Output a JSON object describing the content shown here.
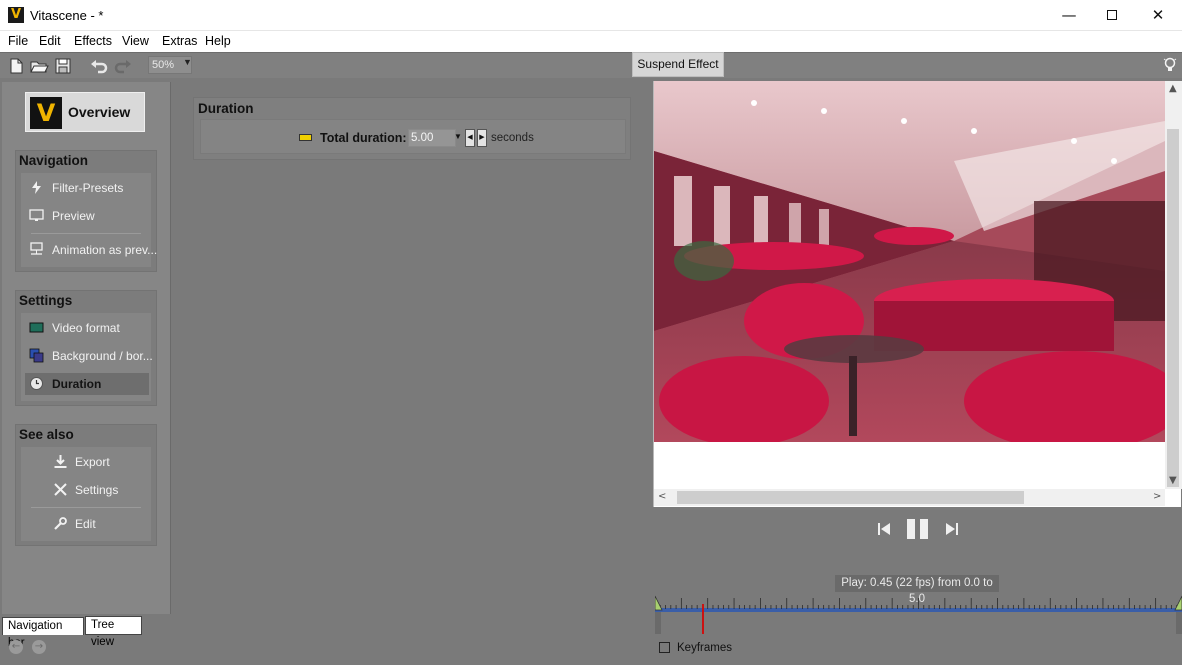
{
  "window": {
    "title": "Vitascene - *",
    "app_icon_letter": "V",
    "minimize_glyph": "—",
    "close_glyph": "✕"
  },
  "menu": [
    {
      "label": "File"
    },
    {
      "label": "Edit"
    },
    {
      "label": "Effects"
    },
    {
      "label": "View"
    },
    {
      "label": "Extras"
    },
    {
      "label": "Help"
    }
  ],
  "toolbar": {
    "zoom_value": "50%",
    "suspend_label": "Suspend Effect",
    "icons": [
      "new-document-icon",
      "open-folder-icon",
      "save-icon",
      "undo-icon",
      "redo-icon",
      "lightbulb-icon"
    ]
  },
  "nav": {
    "overview_label": "Overview",
    "overview_letter": "V",
    "navigation": {
      "title": "Navigation",
      "items": [
        {
          "label": "Filter-Presets",
          "icon": "lightning-icon"
        },
        {
          "label": "Preview",
          "icon": "monitor-icon"
        },
        {
          "label": "Animation as prev...",
          "icon": "network-monitor-icon"
        }
      ]
    },
    "settings": {
      "title": "Settings",
      "items": [
        {
          "label": "Video format",
          "icon": "video-format-icon"
        },
        {
          "label": "Background / bor...",
          "icon": "background-icon"
        },
        {
          "label": "Duration",
          "icon": "clock-icon",
          "active": true
        }
      ]
    },
    "see_also": {
      "title": "See also",
      "items": [
        {
          "label": "Export",
          "icon": "download-icon"
        },
        {
          "label": "Settings",
          "icon": "tools-icon"
        },
        {
          "label": "Edit",
          "icon": "wrench-icon"
        }
      ]
    },
    "tabs": [
      {
        "label": "Navigation bar",
        "active": true
      },
      {
        "label": "Tree view",
        "active": false
      }
    ],
    "back_glyph": "←",
    "forward_glyph": "→"
  },
  "duration": {
    "title": "Duration",
    "label": "Total duration:",
    "value": "5.00",
    "unit": "seconds",
    "spin_left": "◀",
    "spin_right": "▶",
    "dropdown_glyph": "▼"
  },
  "scrollbars": {
    "up": "▲",
    "down": "▼",
    "left": "<",
    "right": ">"
  },
  "playback": {
    "info": "Play: 0.45 (22 fps) from 0.0 to 5.0",
    "keyframes_label": "Keyframes",
    "progress_fraction": 0.09
  },
  "colors": {
    "accent_yellow": "#f0b400",
    "timeline_blue": "#3a5ea8",
    "playhead_red": "#cc1111",
    "panel_gray": "#7a7a7a"
  }
}
